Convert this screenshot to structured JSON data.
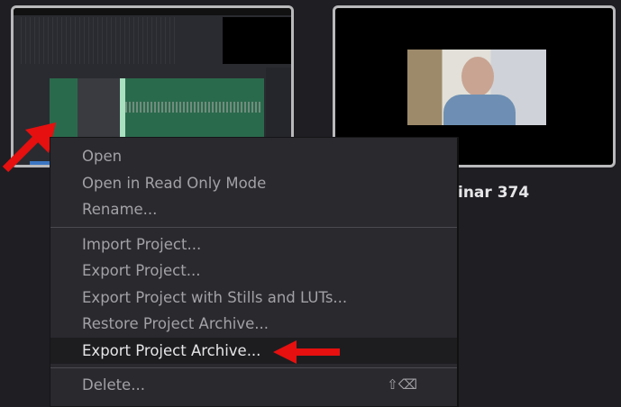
{
  "projects": [
    {
      "title": "",
      "thumbnail": "audio-timeline-screenshot"
    },
    {
      "title": "inar 374",
      "thumbnail": "webcam-presenter"
    }
  ],
  "context_menu": {
    "groups": [
      [
        {
          "label": "Open"
        },
        {
          "label": "Open in Read Only Mode"
        },
        {
          "label": "Rename..."
        }
      ],
      [
        {
          "label": "Import Project..."
        },
        {
          "label": "Export Project..."
        },
        {
          "label": "Export Project with Stills and LUTs..."
        },
        {
          "label": "Restore Project Archive..."
        },
        {
          "label": "Export Project Archive...",
          "highlighted": true
        }
      ],
      [
        {
          "label": "Delete...",
          "shortcut": "⇧⌫"
        }
      ]
    ]
  },
  "colors": {
    "annotation_arrow": "#e5100f",
    "background": "#1f1e23",
    "menu": "#29292e"
  }
}
